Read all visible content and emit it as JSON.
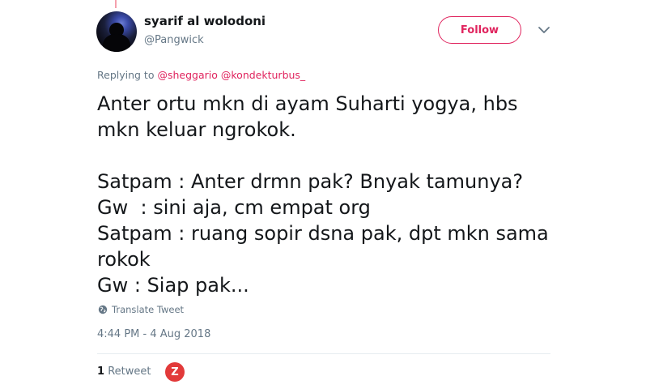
{
  "user": {
    "display_name": "syarif al wolodoni",
    "handle": "@Pangwick",
    "avatar_icon": "user-avatar"
  },
  "actions": {
    "follow_label": "Follow",
    "menu_icon": "chevron-down-icon"
  },
  "reply": {
    "prefix": "Replying to",
    "mentions": [
      "@sheggario",
      "@kondekturbus_"
    ]
  },
  "tweet": {
    "lines": [
      "Anter ortu mkn di ayam Suharti yogya, hbs",
      "mkn keluar ngrokok.",
      "",
      "Satpam : Anter drmn pak? Bnyak tamunya?",
      "Gw  : sini aja, cm empat org",
      "Satpam : ruang sopir dsna pak, dpt mkn sama",
      "rokok",
      "Gw : Siap pak..."
    ]
  },
  "translate": {
    "label": "Translate Tweet",
    "icon": "globe-icon"
  },
  "meta": {
    "timestamp": "4:44 PM - 4 Aug 2018"
  },
  "stats": {
    "retweet_count": "1",
    "retweet_label": "Retweet",
    "retweeter_initial": "Z"
  },
  "colors": {
    "accent": "#e0245e",
    "secondary_text": "#657786",
    "primary_text": "#14171a"
  }
}
